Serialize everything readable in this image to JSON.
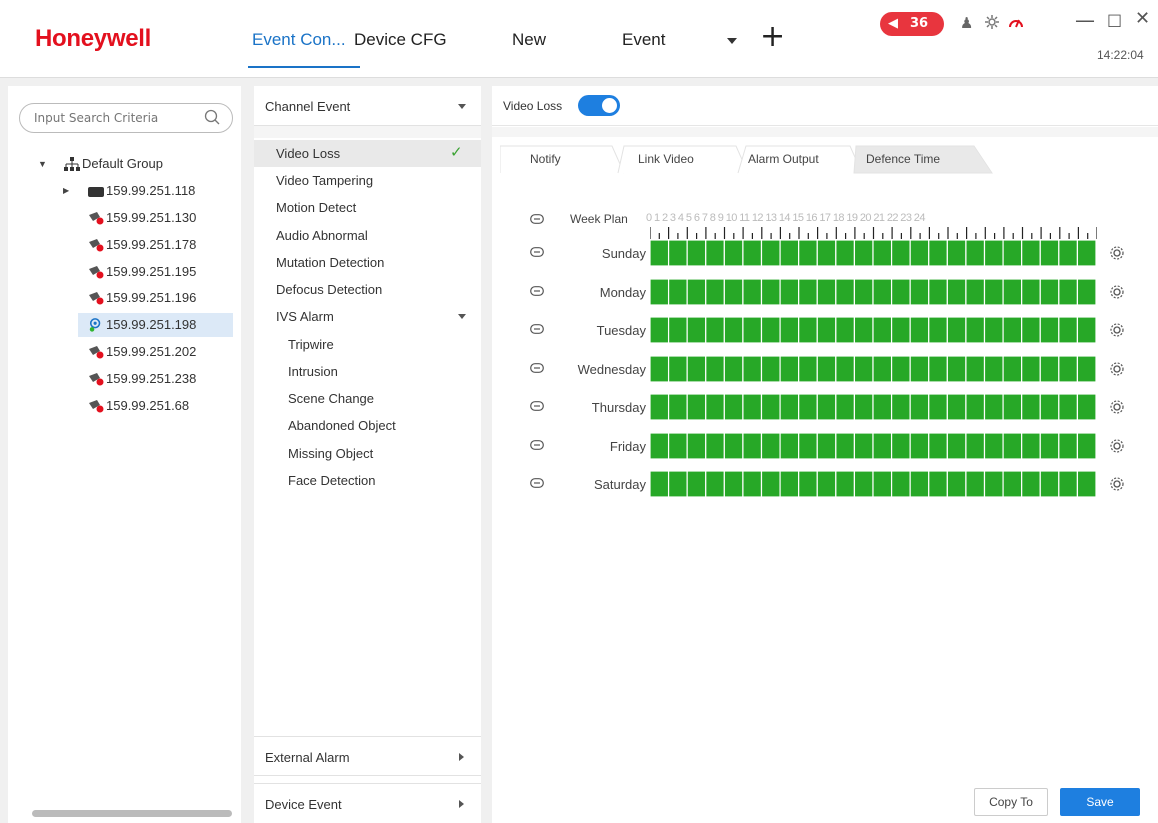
{
  "header": {
    "logo": "Honeywell",
    "tabs": [
      "Event Con...",
      "Device CFG",
      "New",
      "Event"
    ],
    "alarm_count": "36",
    "time": "14:22:04",
    "accent_color": "#1a73c7",
    "alarm_color": "#e8353e"
  },
  "device_tree": {
    "search_placeholder": "Input Search Criteria",
    "group": "Default Group",
    "devices": [
      {
        "ip": "159.99.251.118",
        "status": "online-dvr"
      },
      {
        "ip": "159.99.251.130",
        "status": "offline"
      },
      {
        "ip": "159.99.251.178",
        "status": "offline"
      },
      {
        "ip": "159.99.251.195",
        "status": "offline"
      },
      {
        "ip": "159.99.251.196",
        "status": "offline"
      },
      {
        "ip": "159.99.251.198",
        "status": "online-camera",
        "selected": true
      },
      {
        "ip": "159.99.251.202",
        "status": "offline"
      },
      {
        "ip": "159.99.251.238",
        "status": "offline"
      },
      {
        "ip": "159.99.251.68",
        "status": "offline"
      }
    ]
  },
  "events": {
    "channel_event": "Channel Event",
    "items": [
      "Video Loss",
      "Video Tampering",
      "Motion Detect",
      "Audio Abnormal",
      "Mutation Detection",
      "Defocus Detection"
    ],
    "ivs_alarm": "IVS Alarm",
    "ivs_items": [
      "Tripwire",
      "Intrusion",
      "Scene Change",
      "Abandoned Object",
      "Missing Object",
      "Face Detection"
    ],
    "external_alarm": "External Alarm",
    "device_event": "Device Event"
  },
  "config": {
    "title": "Video Loss",
    "enabled": true,
    "tabs": [
      "Notify",
      "Link Video",
      "Alarm Output",
      "Defence Time"
    ],
    "active_tab": "Defence Time",
    "week_plan_label": "Week Plan",
    "hours": [
      "0",
      "1",
      "2",
      "3",
      "4",
      "5",
      "6",
      "7",
      "8",
      "9",
      "10",
      "11",
      "12",
      "13",
      "14",
      "15",
      "16",
      "17",
      "18",
      "19",
      "20",
      "21",
      "22",
      "23",
      "24"
    ],
    "days": [
      "Sunday",
      "Monday",
      "Tuesday",
      "Wednesday",
      "Thursday",
      "Friday",
      "Saturday"
    ],
    "schedule_color": "#27a827",
    "copy_label": "Copy To",
    "save_label": "Save"
  }
}
